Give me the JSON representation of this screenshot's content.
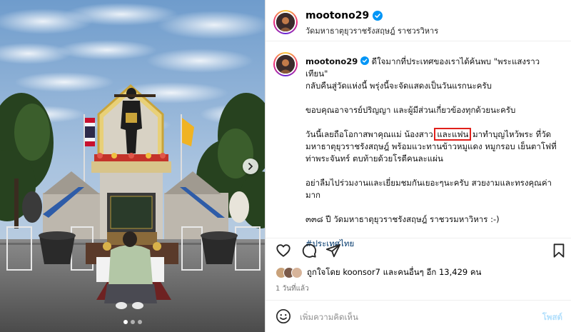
{
  "post": {
    "username": "mootono29",
    "location": "วัดมหาธาตุยุวราชรังสฤษฎ์ ราชวรวิหาร",
    "caption": {
      "line1": "ดีใจมากที่ประเทศของเราได้ค้นพบ \"พระแสงราวเทียน\"",
      "line2": "กลับคืนสู่วัดแห่งนี้ พรุ่งนี้จะจัดแสดงเป็นวันแรกนะครับ",
      "para2": "ขอบคุณอาจารย์ปริญญา และผู้มีส่วนเกี่ยวข้องทุกด้วยนะครับ",
      "para3_pre": "วันนี้เลยถือโอกาสพาคุณแม่ น้องสาว ",
      "para3_highlight": "และแฟน",
      "para3_post1": " มาทำบุญไหว้พระ ที่วัด",
      "para3_line2": "มหาธาตุยุวราชรังสฤษฎ์ พร้อมแวะทานข้าวหมูแดง หมูกรอบ เย็นตาโฟที่",
      "para3_line3": "ท่าพระจันทร์ ตบท้ายด้วยโรตีคนละแผ่น",
      "para4_line1": "อย่าลืมไปร่วมงานและเยี่ยมชมกันเยอะๆนะครับ สวยงามและทรงคุณค่า",
      "para4_line2": "มาก",
      "para5": "๓๓๘ ปี วัดมหาธาตุยุวราชรังสฤษฎ์ ราชวรมหาวิหาร :-)",
      "hashtag": "#ประเทศไทย"
    },
    "likes_text": "ถูกใจโดย koonsor7 และคนอื่นๆ อีก 13,429 คน",
    "time": "1 วันที่แล้ว"
  },
  "comment": {
    "placeholder": "เพิ่มความคิดเห็น",
    "post_label": "โพสต์"
  },
  "carousel": {
    "slides": 3,
    "active_slide": 1
  },
  "colors": {
    "link": "#00376b",
    "highlight_box": "#e0201b",
    "verified": "#0095f6",
    "post_button_disabled": "#b2dffc"
  },
  "icons": {
    "verified": "verified-badge-icon",
    "like": "heart-icon",
    "comment": "comment-icon",
    "share": "paper-plane-icon",
    "save": "bookmark-icon",
    "emoji": "smiley-icon",
    "next": "chevron-right-icon"
  }
}
